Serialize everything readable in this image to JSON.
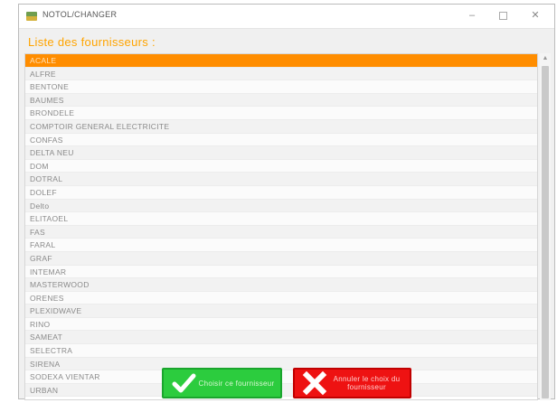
{
  "window": {
    "title": "NOTOL/CHANGER",
    "icons": {
      "app": "app-icon",
      "minimize": "minimize-icon",
      "maximize": "maximize-icon",
      "close": "close-icon"
    }
  },
  "heading": "Liste des fournisseurs :",
  "suppliers": [
    "ACALE",
    "ALFRE",
    "BENTONE",
    "BAUMES",
    "BRONDELE",
    "COMPTOIR GENERAL ELECTRICITE",
    "CONFAS",
    "DELTA NEU",
    "DOM",
    "DOTRAL",
    "DOLEF",
    "Delto",
    "ELITAOEL",
    "FAS",
    "FARAL",
    "GRAF",
    "INTEMAR",
    "MASTERWOOD",
    "ORENES",
    "PLEXIDWAVE",
    "RINO",
    "SAMEAT",
    "SELECTRA",
    "SIRENA",
    "SODEXA VIENTAR",
    "URBAN"
  ],
  "selected_index": 0,
  "buttons": {
    "ok": {
      "label": "Choisir ce fournisseur",
      "icon": "check-icon",
      "color": "#2ccc3e"
    },
    "cancel": {
      "label": "Annuler le choix du\nfournisseur",
      "icon": "cross-icon",
      "color": "#ee1212"
    }
  },
  "colors": {
    "accent": "#ff8d00",
    "heading": "#ffa400"
  }
}
